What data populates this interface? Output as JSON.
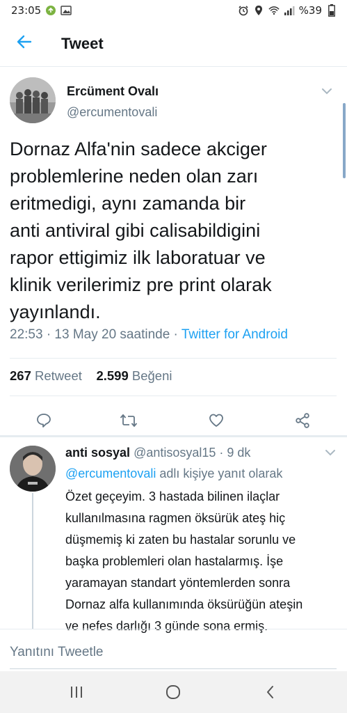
{
  "status_bar": {
    "time": "23:05",
    "battery": "%39"
  },
  "header": {
    "title": "Tweet"
  },
  "tweet": {
    "author_name": "Ercüment Ovalı",
    "author_handle": "@ercumentovali",
    "text": "Dornaz Alfa'nin sadece akciger\nproblemlerine neden olan zarı\neritmedigi, aynı zamanda bir\nanti  antiviral gibi calisabildigini\nrapor ettigimiz ilk laboratuar ve\nklinik verilerimiz pre print olarak\nyayınlandı.",
    "timestamp": "22:53 · 13 May 20 saatinde · ",
    "source": "Twitter for Android",
    "retweet_count": "267",
    "retweet_label": "Retweet",
    "like_count": "2.599",
    "like_label": "Beğeni"
  },
  "reply": {
    "name": "anti sosyal",
    "handle_time": "@antisosyal15 · 9 dk",
    "mention": "@ercumentovali",
    "reply_suffix": "adlı kişiye yanıt olarak",
    "text": "Özet geçeyim. 3 hastada bilinen ilaçlar\nkullanılmasına ragmen öksürük ateş hiç\ndüşmemiş ki zaten bu hastalar sorunlu ve\nbaşka problemleri olan hastalarmış. İşe\nyaramayan standart yöntemlerden sonra\nDornaz alfa kullanımında öksürüğün ateşin\nve nefes darlığı 3 günde sona ermiş."
  },
  "compose": {
    "placeholder": "Yanıtını Tweetle"
  },
  "icons": {
    "back": "back-arrow-icon",
    "caret": "chevron-down-icon",
    "reply": "reply-icon",
    "retweet": "retweet-icon",
    "like": "heart-icon",
    "share": "share-icon"
  },
  "colors": {
    "accent": "#1da1f2",
    "secondary_text": "#657786",
    "primary_text": "#14171a",
    "divider": "#e6ecf0"
  }
}
